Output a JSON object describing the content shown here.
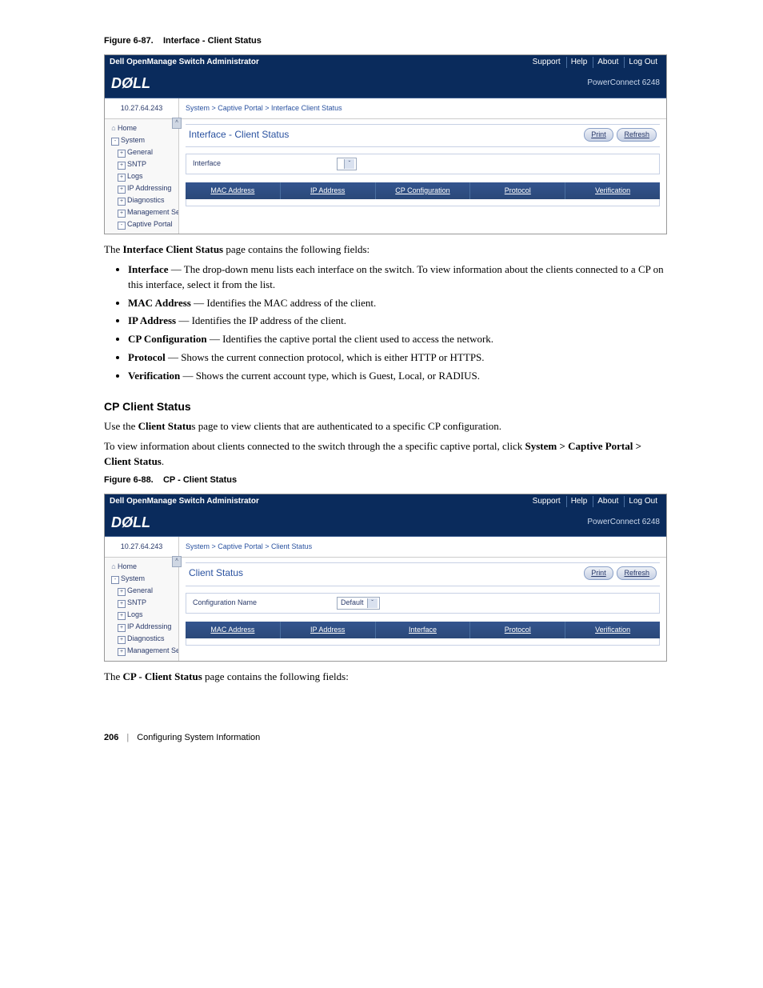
{
  "figA": {
    "caption_num": "Figure 6-87.",
    "caption_title": "Interface - Client Status",
    "topbar_title": "Dell OpenManage Switch Administrator",
    "top_links": [
      "Support",
      "Help",
      "About",
      "Log Out"
    ],
    "logo": "DØLL",
    "model": "PowerConnect 6248",
    "ip": "10.27.64.243",
    "crumb": "System > Captive Portal > Interface Client Status",
    "side": [
      {
        "type": "home",
        "text": "Home"
      },
      {
        "type": "l1",
        "tog": "-",
        "text": "System"
      },
      {
        "type": "l2",
        "tog": "+",
        "text": "General"
      },
      {
        "type": "l2",
        "tog": "+",
        "text": "SNTP"
      },
      {
        "type": "l2",
        "tog": "+",
        "text": "Logs"
      },
      {
        "type": "l2",
        "tog": "+",
        "text": "IP Addressing"
      },
      {
        "type": "l2",
        "tog": "+",
        "text": "Diagnostics"
      },
      {
        "type": "l2",
        "tog": "+",
        "text": "Management Secur"
      },
      {
        "type": "l2",
        "tog": "-",
        "text": "Captive Portal"
      }
    ],
    "panel_title": "Interface - Client Status",
    "btn_print": "Print",
    "btn_refresh": "Refresh",
    "field_label": "Interface",
    "columns": [
      "MAC Address",
      "IP Address",
      "CP Configuration",
      "Protocol",
      "Verification"
    ]
  },
  "after_figA_intro_pre": "The ",
  "after_figA_intro_bold": "Interface Client Status",
  "after_figA_intro_post": " page contains the following fields:",
  "bulletsA": [
    {
      "term": "Interface",
      "desc": " — The drop-down menu lists each interface on the switch. To view information about the clients connected to a CP on this interface, select it from the list."
    },
    {
      "term": "MAC Address",
      "desc": " — Identifies the MAC address of the client."
    },
    {
      "term": "IP Address",
      "desc": " — Identifies the IP address of the client."
    },
    {
      "term": "CP Configuration",
      "desc": " — Identifies the captive portal the client used to access the network."
    },
    {
      "term": "Protocol",
      "desc": " — Shows the current connection protocol, which is either HTTP or HTTPS."
    },
    {
      "term": "Verification",
      "desc": " — Shows the current account type, which is Guest, Local, or RADIUS."
    }
  ],
  "sectionB_head": "CP Client Status",
  "sectionB_p1_pre": "Use the ",
  "sectionB_p1_bold": "Client Statu",
  "sectionB_p1_post": "s page to view clients that are authenticated to a specific CP configuration.",
  "sectionB_p2_pre": "To view information about clients connected to the switch through the a specific captive portal, click ",
  "sectionB_p2_bold": "System > Captive Portal > Client Status",
  "sectionB_p2_post": ".",
  "figB": {
    "caption_num": "Figure 6-88.",
    "caption_title": "CP - Client Status",
    "topbar_title": "Dell OpenManage Switch Administrator",
    "top_links": [
      "Support",
      "Help",
      "About",
      "Log Out"
    ],
    "logo": "DØLL",
    "model": "PowerConnect 6248",
    "ip": "10.27.64.243",
    "crumb": "System > Captive Portal > Client Status",
    "side": [
      {
        "type": "home",
        "text": "Home"
      },
      {
        "type": "l1",
        "tog": "-",
        "text": "System"
      },
      {
        "type": "l2",
        "tog": "+",
        "text": "General"
      },
      {
        "type": "l2",
        "tog": "+",
        "text": "SNTP"
      },
      {
        "type": "l2",
        "tog": "+",
        "text": "Logs"
      },
      {
        "type": "l2",
        "tog": "+",
        "text": "IP Addressing"
      },
      {
        "type": "l2",
        "tog": "+",
        "text": "Diagnostics"
      },
      {
        "type": "l2",
        "tog": "+",
        "text": "Management Secur"
      }
    ],
    "panel_title": "Client Status",
    "btn_print": "Print",
    "btn_refresh": "Refresh",
    "field_label": "Configuration Name",
    "dd_value": "Default",
    "columns": [
      "MAC Address",
      "IP Address",
      "Interface",
      "Protocol",
      "Verification"
    ]
  },
  "after_figB_intro_pre": "The ",
  "after_figB_intro_bold": "CP - Client Status",
  "after_figB_intro_post": " page contains the following fields:",
  "footer_page": "206",
  "footer_sep": "|",
  "footer_section": "Configuring System Information"
}
